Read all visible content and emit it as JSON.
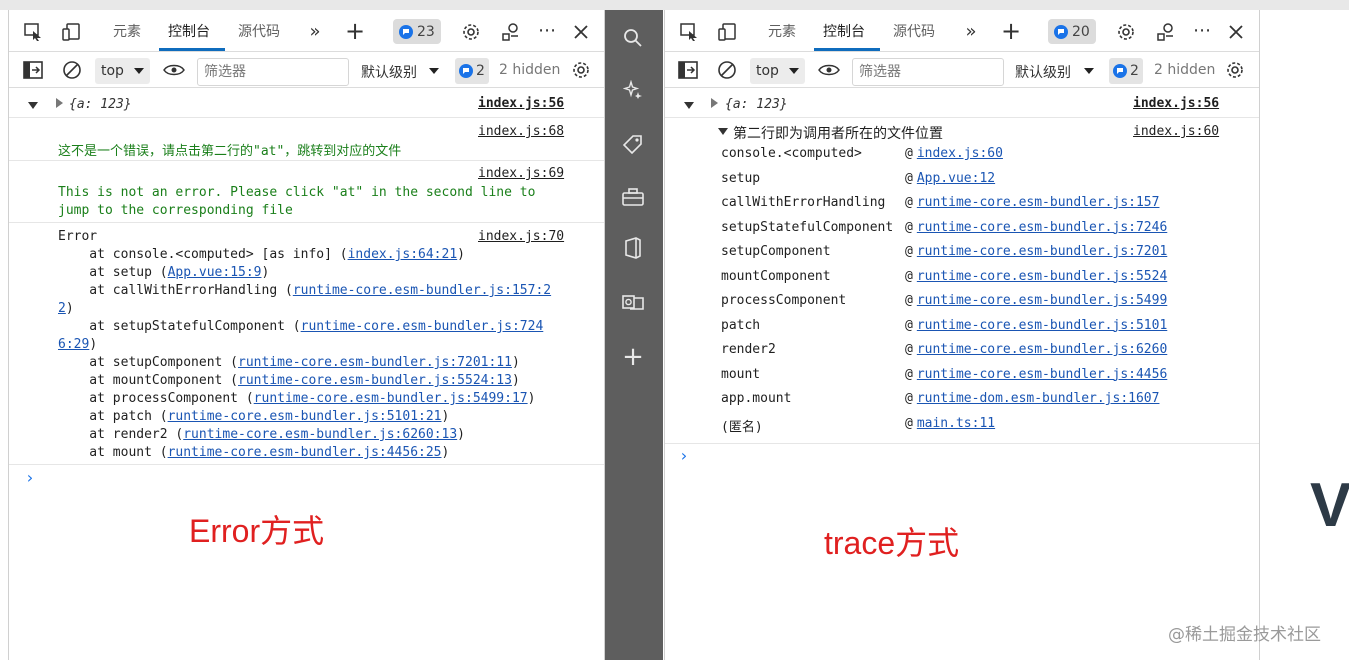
{
  "left": {
    "tabs": {
      "elements": "元素",
      "console": "控制台",
      "sources": "源代码"
    },
    "issues_count": "23",
    "toolbar": {
      "context": "top",
      "filter_placeholder": "筛选器",
      "levels": "默认级别",
      "msg_count": "2",
      "hidden": "2 hidden"
    },
    "log_object": "{a: 123}",
    "log_object_src": "index.js:56",
    "msg1": {
      "src": "index.js:68",
      "text": "这不是一个错误，请点击第二行的\"at\"，跳转到对应的文件"
    },
    "msg2": {
      "src": "index.js:69",
      "line1": "This is not an error. Please click \"at\" in the second line to",
      "line2": "jump to the corresponding file"
    },
    "error": {
      "src": "index.js:70",
      "title": "Error",
      "frames": [
        {
          "prefix": "    at console.<computed> [as info] (",
          "link": "index.js:64:21",
          "suffix": ")"
        },
        {
          "prefix": "    at setup (",
          "link": "App.vue:15:9",
          "suffix": ")"
        },
        {
          "prefix": "    at callWithErrorHandling (",
          "link": "runtime-core.esm-bundler.js:157:2",
          "suffix": ""
        },
        {
          "prefix": "",
          "link": "2",
          "suffix": ")"
        },
        {
          "prefix": "    at setupStatefulComponent (",
          "link": "runtime-core.esm-bundler.js:724",
          "suffix": ""
        },
        {
          "prefix": "",
          "link": "6:29",
          "suffix": ")"
        },
        {
          "prefix": "    at setupComponent (",
          "link": "runtime-core.esm-bundler.js:7201:11",
          "suffix": ")"
        },
        {
          "prefix": "    at mountComponent (",
          "link": "runtime-core.esm-bundler.js:5524:13",
          "suffix": ")"
        },
        {
          "prefix": "    at processComponent (",
          "link": "runtime-core.esm-bundler.js:5499:17",
          "suffix": ")"
        },
        {
          "prefix": "    at patch (",
          "link": "runtime-core.esm-bundler.js:5101:21",
          "suffix": ")"
        },
        {
          "prefix": "    at render2 (",
          "link": "runtime-core.esm-bundler.js:6260:13",
          "suffix": ")"
        },
        {
          "prefix": "    at mount (",
          "link": "runtime-core.esm-bundler.js:4456:25",
          "suffix": ")"
        }
      ]
    },
    "caption": "Error方式"
  },
  "right": {
    "tabs": {
      "elements": "元素",
      "console": "控制台",
      "sources": "源代码"
    },
    "issues_count": "20",
    "toolbar": {
      "context": "top",
      "filter_placeholder": "筛选器",
      "levels": "默认级别",
      "msg_count": "2",
      "hidden": "2 hidden"
    },
    "log_object": "{a: 123}",
    "log_object_src": "index.js:56",
    "trace": {
      "title": "第二行即为调用者所在的文件位置",
      "src": "index.js:60",
      "rows": [
        {
          "fn": "console.<computed>",
          "link": "index.js:60"
        },
        {
          "fn": "setup",
          "link": "App.vue:12"
        },
        {
          "fn": "callWithErrorHandling",
          "link": "runtime-core.esm-bundler.js:157"
        },
        {
          "fn": "setupStatefulComponent",
          "link": "runtime-core.esm-bundler.js:7246"
        },
        {
          "fn": "setupComponent",
          "link": "runtime-core.esm-bundler.js:7201"
        },
        {
          "fn": "mountComponent",
          "link": "runtime-core.esm-bundler.js:5524"
        },
        {
          "fn": "processComponent",
          "link": "runtime-core.esm-bundler.js:5499"
        },
        {
          "fn": "patch",
          "link": "runtime-core.esm-bundler.js:5101"
        },
        {
          "fn": "render2",
          "link": "runtime-core.esm-bundler.js:6260"
        },
        {
          "fn": "mount",
          "link": "runtime-core.esm-bundler.js:4456"
        },
        {
          "fn": "app.mount",
          "link": "runtime-dom.esm-bundler.js:1607"
        },
        {
          "fn": "(匿名)",
          "link": "main.ts:11"
        }
      ]
    },
    "caption": "trace方式"
  },
  "at_symbol": "@",
  "watermark": "@稀土掘金技术社区",
  "edge_letter": "V",
  "prompt_symbol": "›"
}
